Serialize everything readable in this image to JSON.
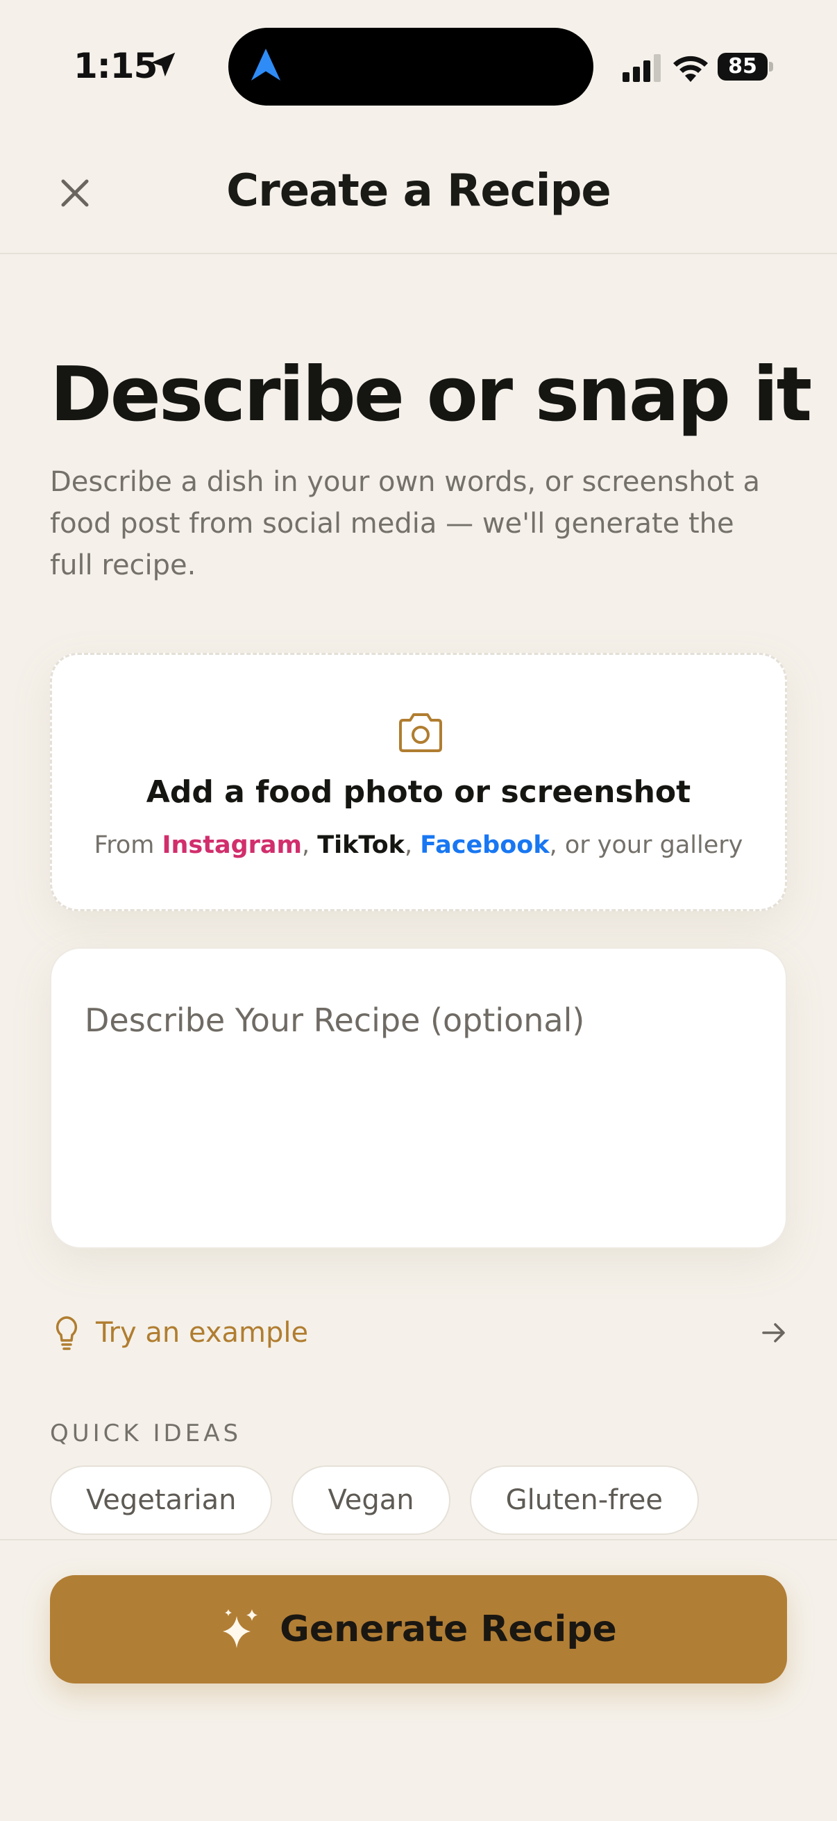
{
  "status_bar": {
    "time": "1:15",
    "battery": "85"
  },
  "header": {
    "title": "Create a Recipe"
  },
  "hero": {
    "title": "Describe or snap it",
    "subtitle": "Describe a dish in your own words, or screenshot a food post from social media — we'll generate the full recipe."
  },
  "photo_card": {
    "title": "Add a food photo or screenshot",
    "sub_prefix": "From ",
    "brand_instagram": "Instagram",
    "sep1": ", ",
    "brand_tiktok": "TikTok",
    "sep2": ", ",
    "brand_facebook": "Facebook",
    "sub_suffix": ", or your gallery"
  },
  "description": {
    "placeholder": "Describe Your Recipe (optional)",
    "value": ""
  },
  "try_example": {
    "label": "Try an example"
  },
  "quick_ideas": {
    "label": "QUICK IDEAS",
    "chips": [
      "Vegetarian",
      "Vegan",
      "Gluten-free"
    ]
  },
  "generate_button": {
    "label": "Generate Recipe"
  },
  "colors": {
    "background": "#F5F1EA",
    "accent": "#B17E35",
    "instagram": "#D12E6C",
    "facebook": "#1877F2",
    "nav_blue": "#2F8CF6"
  },
  "icons": {
    "close": "close-icon",
    "camera": "camera-icon",
    "bulb": "lightbulb-icon",
    "arrow": "arrow-right-icon",
    "sparkle": "sparkle-icon"
  }
}
